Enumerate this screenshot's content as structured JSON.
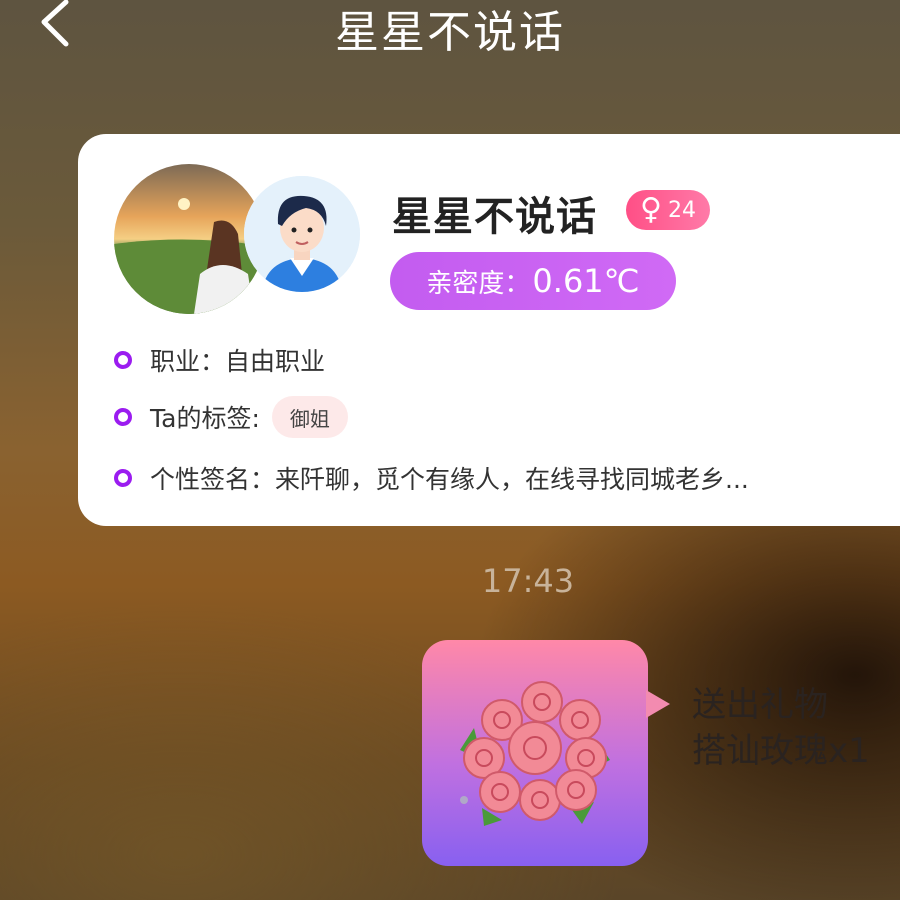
{
  "header": {
    "title": "星星不说话"
  },
  "profile": {
    "name": "星星不说话",
    "gender_symbol": "♀",
    "age": "24",
    "intimacy_label": "亲密度：",
    "intimacy_value": "0.61℃",
    "job": "职业：自由职业",
    "tags_label": "Ta的标签:",
    "tag": "御姐",
    "signature": "个性签名：来阡聊，觅个有缘人，在线寻找同城老乡..."
  },
  "chat": {
    "time": "17:43",
    "gift_line1": "送出礼物",
    "gift_line2": "搭讪玫瑰x1"
  },
  "colors": {
    "accent_purple": "#9b1cf0",
    "intimacy": "#c35cf0",
    "gender_badge": "#ff5a8c"
  },
  "icons": [
    "back-chevron-icon",
    "female-icon",
    "rose-bouquet-icon"
  ]
}
